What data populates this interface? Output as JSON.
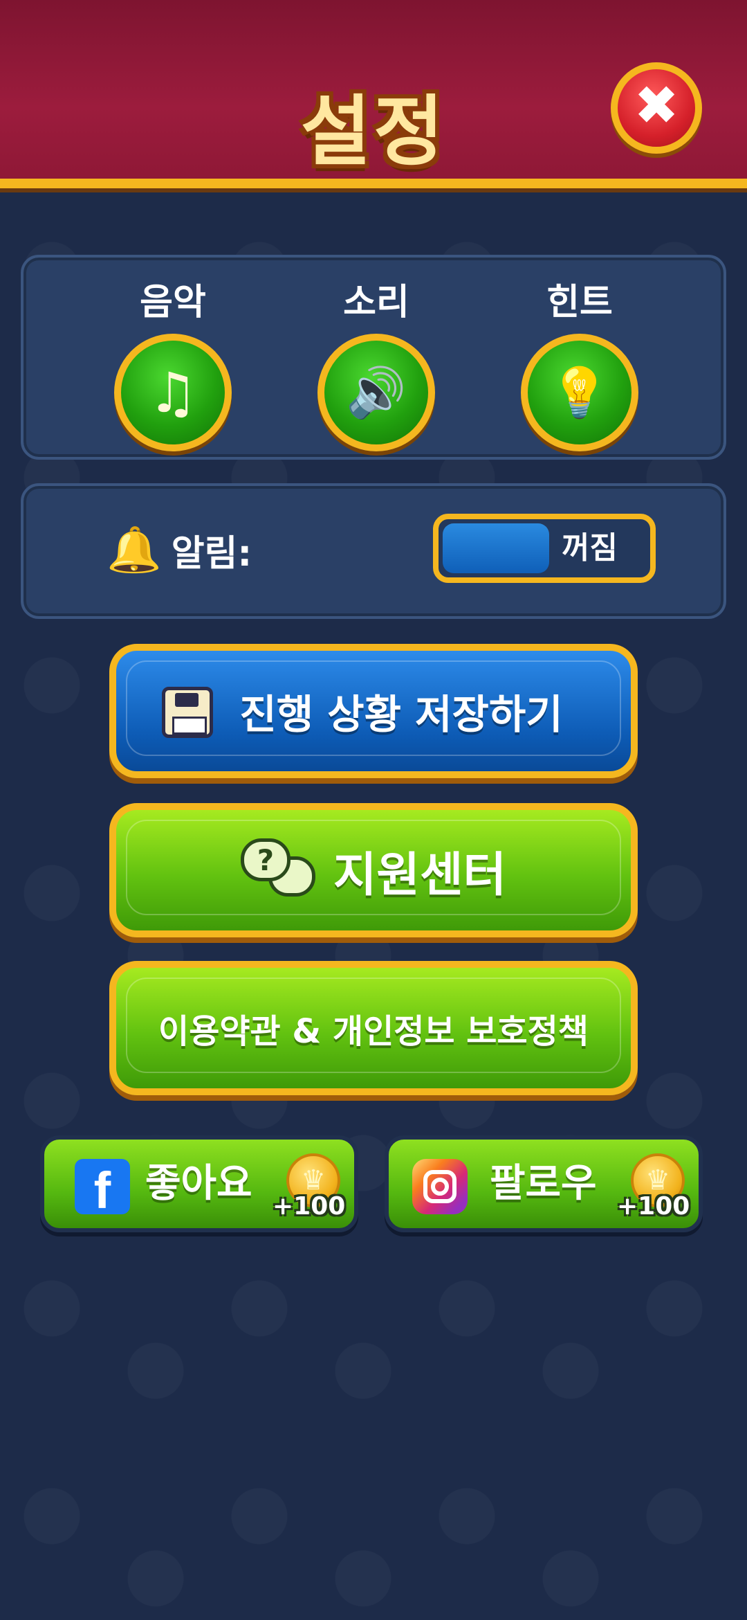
{
  "header": {
    "title": "설정",
    "close_icon": "close-icon"
  },
  "toggles": [
    {
      "label": "음악",
      "icon": "music-note-icon",
      "glyph": "♫"
    },
    {
      "label": "소리",
      "icon": "speaker-icon",
      "glyph": "🔊"
    },
    {
      "label": "힌트",
      "icon": "lightbulb-icon",
      "glyph": "💡"
    }
  ],
  "notifications": {
    "label": "알림:",
    "state": "꺼짐",
    "icon": "bell-icon"
  },
  "buttons": {
    "save_progress": "진행 상황 저장하기",
    "support_center": "지원센터",
    "terms_privacy": "이용약관 & 개인정보 보호정책"
  },
  "social": {
    "facebook": {
      "label": "좋아요",
      "reward": "+100",
      "icon": "facebook-icon"
    },
    "instagram": {
      "label": "팔로우",
      "reward": "+100",
      "icon": "instagram-icon"
    }
  },
  "colors": {
    "header": "#9c1c3d",
    "gold": "#f5b71f",
    "background": "#1d2b49",
    "green": "#62c210",
    "blue": "#0d5bb5"
  }
}
